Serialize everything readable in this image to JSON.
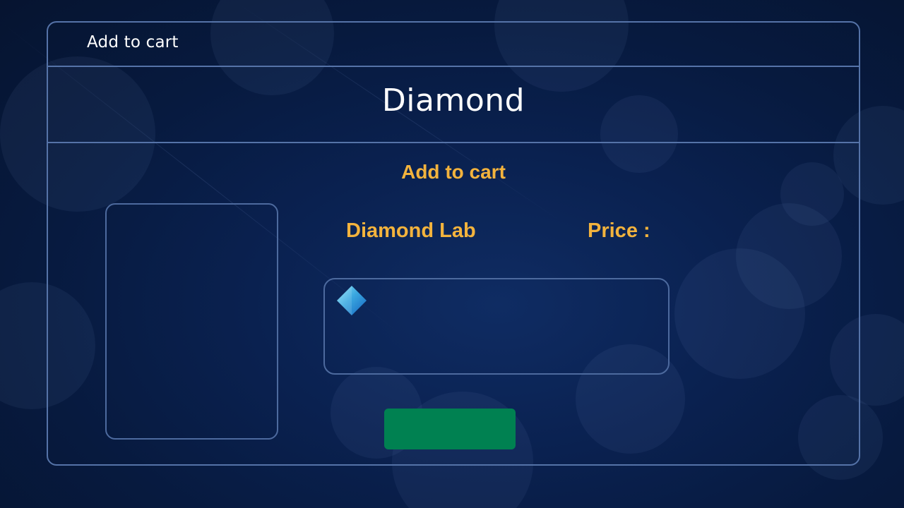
{
  "header": {
    "label": "Add to cart"
  },
  "page": {
    "title": "Diamond"
  },
  "main": {
    "heading": "Add to cart",
    "product_name": "Diamond Lab",
    "price_label": "Price :",
    "add_button_label": ""
  },
  "icons": {
    "product": "diamond-icon"
  },
  "colors": {
    "accent": "#f3b33d",
    "button": "#008151",
    "border": "#5573a8",
    "background": "#0a2150"
  }
}
